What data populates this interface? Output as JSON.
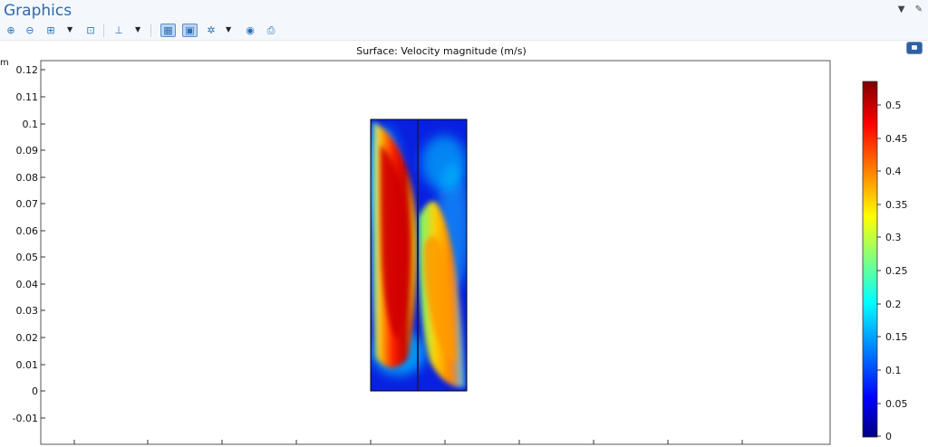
{
  "window": {
    "title": "Graphics"
  },
  "toolbar": {
    "buttons": [
      {
        "name": "zoom-in-icon",
        "glyph": "⊕"
      },
      {
        "name": "zoom-out-icon",
        "glyph": "⊖"
      },
      {
        "name": "zoom-box-icon",
        "glyph": "⊞"
      },
      {
        "name": "zoom-extents-icon",
        "glyph": "⊡"
      },
      {
        "name": "axis-orientation-icon",
        "glyph": "⊥"
      },
      {
        "name": "show-grid-icon",
        "glyph": "▦"
      },
      {
        "name": "show-axis-icon",
        "glyph": "▣"
      },
      {
        "name": "rotate-icon",
        "glyph": "✲"
      },
      {
        "name": "camera-icon",
        "glyph": "◉"
      },
      {
        "name": "print-icon",
        "glyph": "⎙"
      }
    ]
  },
  "plot": {
    "title": "Surface: Velocity magnitude (m/s)",
    "y_unit": "m",
    "y_ticks": [
      "0.12",
      "0.11",
      "0.1",
      "0.09",
      "0.08",
      "0.07",
      "0.06",
      "0.05",
      "0.04",
      "0.03",
      "0.02",
      "0.01",
      "0",
      "-0.01"
    ]
  },
  "colorbar": {
    "ticks": [
      "0.5",
      "0.45",
      "0.4",
      "0.35",
      "0.3",
      "0.25",
      "0.2",
      "0.15",
      "0.1",
      "0.05",
      "0"
    ],
    "colors": [
      "#000080",
      "#0000ff",
      "#00a0ff",
      "#00ffff",
      "#80ff80",
      "#ffff00",
      "#ff8000",
      "#ff0000",
      "#800000"
    ]
  }
}
